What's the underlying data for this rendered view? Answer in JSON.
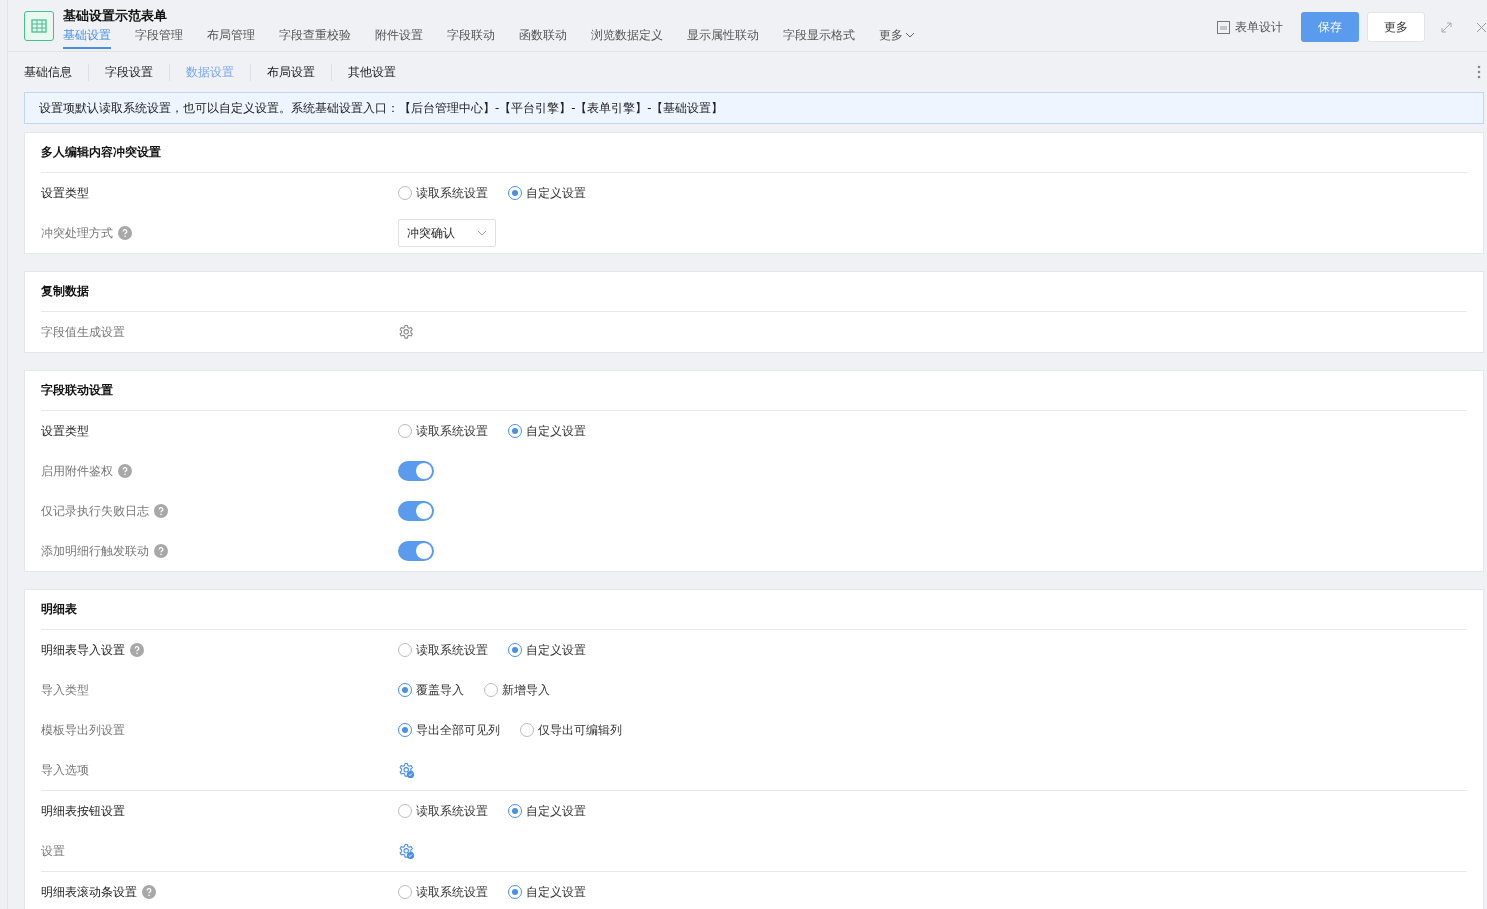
{
  "header": {
    "title": "基础设置示范表单",
    "tabs": [
      {
        "label": "基础设置",
        "selected": true
      },
      {
        "label": "字段管理",
        "selected": false
      },
      {
        "label": "布局管理",
        "selected": false
      },
      {
        "label": "字段查重校验",
        "selected": false
      },
      {
        "label": "附件设置",
        "selected": false
      },
      {
        "label": "字段联动",
        "selected": false
      },
      {
        "label": "函数联动",
        "selected": false
      },
      {
        "label": "浏览数据定义",
        "selected": false
      },
      {
        "label": "显示属性联动",
        "selected": false
      },
      {
        "label": "字段显示格式",
        "selected": false
      }
    ],
    "more_tab": "更多",
    "design_link": "表单设计",
    "save_button": "保存",
    "more_button": "更多"
  },
  "subtabs": [
    {
      "label": "基础信息",
      "selected": false
    },
    {
      "label": "字段设置",
      "selected": false
    },
    {
      "label": "数据设置",
      "selected": true
    },
    {
      "label": "布局设置",
      "selected": false
    },
    {
      "label": "其他设置",
      "selected": false
    }
  ],
  "notice": "设置项默认读取系统设置，也可以自定义设置。系统基础设置入口：【后台管理中心】-【平台引擎】-【表单引擎】-【基础设置】",
  "sections": [
    {
      "title": "多人编辑内容冲突设置",
      "rows": [
        {
          "kind": "radio",
          "label": "设置类型",
          "secondary": false,
          "help": false,
          "divider_before": false,
          "options": [
            {
              "label": "读取系统设置",
              "selected": false
            },
            {
              "label": "自定义设置",
              "selected": true
            }
          ]
        },
        {
          "kind": "select",
          "label": "冲突处理方式",
          "secondary": true,
          "help": true,
          "divider_before": false,
          "value": "冲突确认"
        }
      ]
    },
    {
      "title": "复制数据",
      "rows": [
        {
          "kind": "gear",
          "label": "字段值生成设置",
          "secondary": true,
          "help": false,
          "divider_before": false,
          "configured": false
        }
      ]
    },
    {
      "title": "字段联动设置",
      "rows": [
        {
          "kind": "radio",
          "label": "设置类型",
          "secondary": false,
          "help": false,
          "divider_before": false,
          "options": [
            {
              "label": "读取系统设置",
              "selected": false
            },
            {
              "label": "自定义设置",
              "selected": true
            }
          ]
        },
        {
          "kind": "toggle",
          "label": "启用附件鉴权",
          "secondary": true,
          "help": true,
          "divider_before": false,
          "on": true
        },
        {
          "kind": "toggle",
          "label": "仅记录执行失败日志",
          "secondary": true,
          "help": true,
          "divider_before": false,
          "on": true
        },
        {
          "kind": "toggle",
          "label": "添加明细行触发联动",
          "secondary": true,
          "help": true,
          "divider_before": false,
          "on": true
        }
      ]
    },
    {
      "title": "明细表",
      "rows": [
        {
          "kind": "radio",
          "label": "明细表导入设置",
          "secondary": false,
          "help": true,
          "divider_before": false,
          "options": [
            {
              "label": "读取系统设置",
              "selected": false
            },
            {
              "label": "自定义设置",
              "selected": true
            }
          ]
        },
        {
          "kind": "radio",
          "label": "导入类型",
          "secondary": true,
          "help": false,
          "divider_before": false,
          "options": [
            {
              "label": "覆盖导入",
              "selected": true
            },
            {
              "label": "新增导入",
              "selected": false
            }
          ]
        },
        {
          "kind": "radio",
          "label": "模板导出列设置",
          "secondary": true,
          "help": false,
          "divider_before": false,
          "options": [
            {
              "label": "导出全部可见列",
              "selected": true
            },
            {
              "label": "仅导出可编辑列",
              "selected": false
            }
          ]
        },
        {
          "kind": "gear",
          "label": "导入选项",
          "secondary": true,
          "help": false,
          "divider_before": false,
          "configured": true
        },
        {
          "kind": "radio",
          "label": "明细表按钮设置",
          "secondary": false,
          "help": false,
          "divider_before": true,
          "options": [
            {
              "label": "读取系统设置",
              "selected": false
            },
            {
              "label": "自定义设置",
              "selected": true
            }
          ]
        },
        {
          "kind": "gear",
          "label": "设置",
          "secondary": true,
          "help": false,
          "divider_before": false,
          "configured": true
        },
        {
          "kind": "radio",
          "label": "明细表滚动条设置",
          "secondary": false,
          "help": true,
          "divider_before": true,
          "options": [
            {
              "label": "读取系统设置",
              "selected": false
            },
            {
              "label": "自定义设置",
              "selected": true
            }
          ]
        }
      ]
    }
  ]
}
